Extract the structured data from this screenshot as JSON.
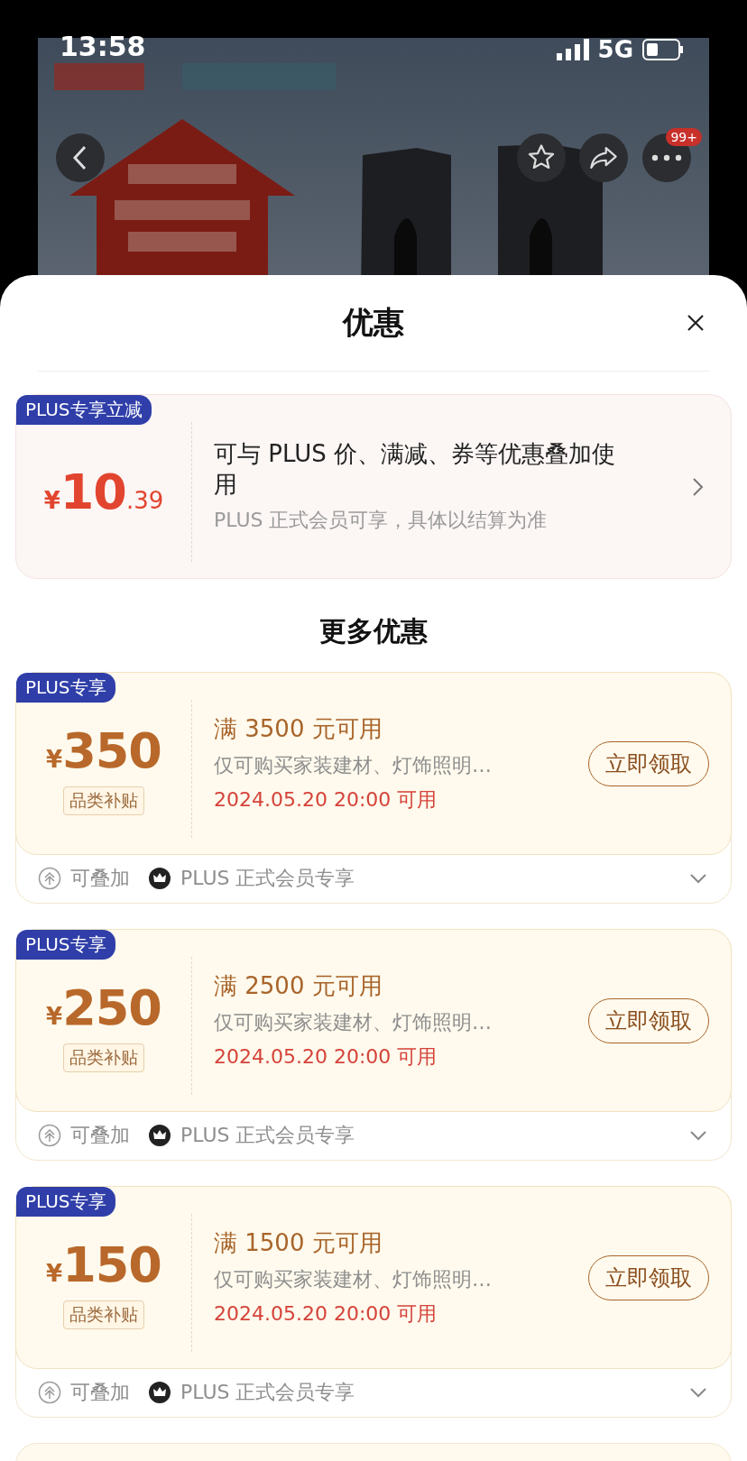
{
  "status_bar": {
    "time": "13:58",
    "network": "5G"
  },
  "header_actions": {
    "more_badge": "99+"
  },
  "sheet": {
    "title": "优惠"
  },
  "plus_discount": {
    "badge": "PLUS专享立减",
    "currency": "¥",
    "amount": "10",
    "decimals": ".39",
    "title": "可与 PLUS 价、满减、券等优惠叠加使用",
    "note": "PLUS 正式会员可享，具体以结算为准"
  },
  "more_title": "更多优惠",
  "coupons": [
    {
      "badge": "PLUS专享",
      "currency": "¥",
      "amount": "350",
      "category": "品类补贴",
      "condition": "满 3500 元可用",
      "scope": "仅可购买家装建材、灯饰照明…",
      "time": "2024.05.20 20:00 可用",
      "button": "立即领取",
      "stackable": "可叠加",
      "membership": "PLUS 正式会员专享",
      "expanded": false
    },
    {
      "badge": "PLUS专享",
      "currency": "¥",
      "amount": "250",
      "category": "品类补贴",
      "condition": "满 2500 元可用",
      "scope": "仅可购买家装建材、灯饰照明…",
      "time": "2024.05.20 20:00 可用",
      "button": "立即领取",
      "stackable": "可叠加",
      "membership": "PLUS 正式会员专享",
      "expanded": false
    },
    {
      "badge": "PLUS专享",
      "currency": "¥",
      "amount": "150",
      "category": "品类补贴",
      "condition": "满 1500 元可用",
      "scope": "仅可购买家装建材、灯饰照明…",
      "time": "2024.05.20 20:00 可用",
      "button": "立即领取",
      "stackable": "可叠加",
      "membership": "PLUS 正式会员专享",
      "expanded": false
    }
  ]
}
